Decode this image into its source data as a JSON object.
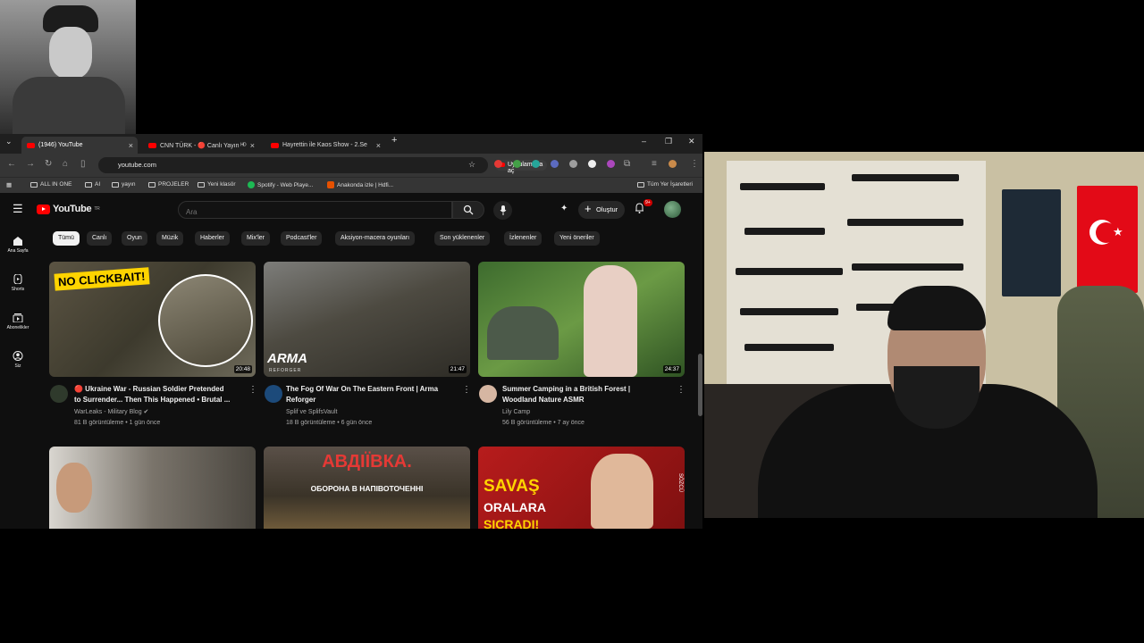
{
  "browser": {
    "tabs": [
      {
        "label": "(1946) YouTube"
      },
      {
        "label": "CNN TÜRK - 🔴 Canlı Yayın ᴴᴰ"
      },
      {
        "label": "Hayrettin ile Kaos Show - 2.Se"
      }
    ],
    "url": "youtube.com",
    "open_in_app": "Uygulamada aç",
    "bookmarks": [
      {
        "label": "ALL IN ONE",
        "icon": "folder-icon"
      },
      {
        "label": "AI",
        "icon": "folder-icon"
      },
      {
        "label": "yayın",
        "icon": "folder-icon"
      },
      {
        "label": "PROJELER",
        "icon": "folder-icon"
      },
      {
        "label": "Yeni klasör",
        "icon": "folder-icon"
      },
      {
        "label": "Spotify - Web Playe...",
        "icon": "spotify-icon"
      },
      {
        "label": "Anakonda izle | Hdfi...",
        "icon": "site-icon"
      }
    ],
    "all_bookmarks": "Tüm Yer İşaretleri"
  },
  "youtube": {
    "logo": "YouTube",
    "logo_region": "TR",
    "search_placeholder": "Ara",
    "create_label": "Oluştur",
    "notification_badge": "9+",
    "sidebar": [
      {
        "label": "Ana Sayfa",
        "icon": "home-icon"
      },
      {
        "label": "Shorts",
        "icon": "shorts-icon"
      },
      {
        "label": "Abonelikler",
        "icon": "subscriptions-icon"
      },
      {
        "label": "Siz",
        "icon": "you-icon"
      }
    ],
    "chips": [
      "Tümü",
      "Canlı",
      "Oyun",
      "Müzik",
      "Haberler",
      "Mix'ler",
      "Podcast'ler",
      "Aksiyon-macera oyunları",
      "Son yüklenenler",
      "İzlenenler",
      "Yeni öneriler"
    ],
    "videos": [
      {
        "thumb_text": "NO CLICKBAIT!",
        "duration": "20:48",
        "title_line1": "🔴 Ukraine War - Russian Soldier Pretended",
        "title_line2": "to Surrender... Then This Happened • Brutal ...",
        "channel": "WarLeaks - Military Blog ✔",
        "meta": "81 B görüntüleme • 1 gün önce"
      },
      {
        "thumb_text": "ARMA",
        "thumb_sub": "REFORGER",
        "duration": "21:47",
        "title_line1": "The Fog Of War On The Eastern Front | Arma",
        "title_line2": "Reforger",
        "channel": "Splif ve SplifsVault",
        "meta": "18 B görüntüleme • 6 gün önce"
      },
      {
        "duration": "24:37",
        "title_line1": "Summer Camping in a British Forest |",
        "title_line2": "Woodland Nature ASMR",
        "channel": "Lily Camp",
        "meta": "56 B görüntüleme • 7 ay önce"
      }
    ],
    "row2": [
      {
        "thumb_text": ""
      },
      {
        "thumb_text": "АВДІЇВКА.",
        "thumb_sub": "ОБОРОНА В НАПІВОТОЧЕННІ"
      },
      {
        "thumb_text": "SAVAŞ",
        "thumb_sub": "ORALARA",
        "thumb_sub2": "SIÇRADI!",
        "side_text": "SÖZCÜ"
      }
    ]
  },
  "colors": {
    "yt_red": "#ff0000",
    "yt_bg": "#0f0f0f",
    "chrome_bar": "#353535"
  }
}
